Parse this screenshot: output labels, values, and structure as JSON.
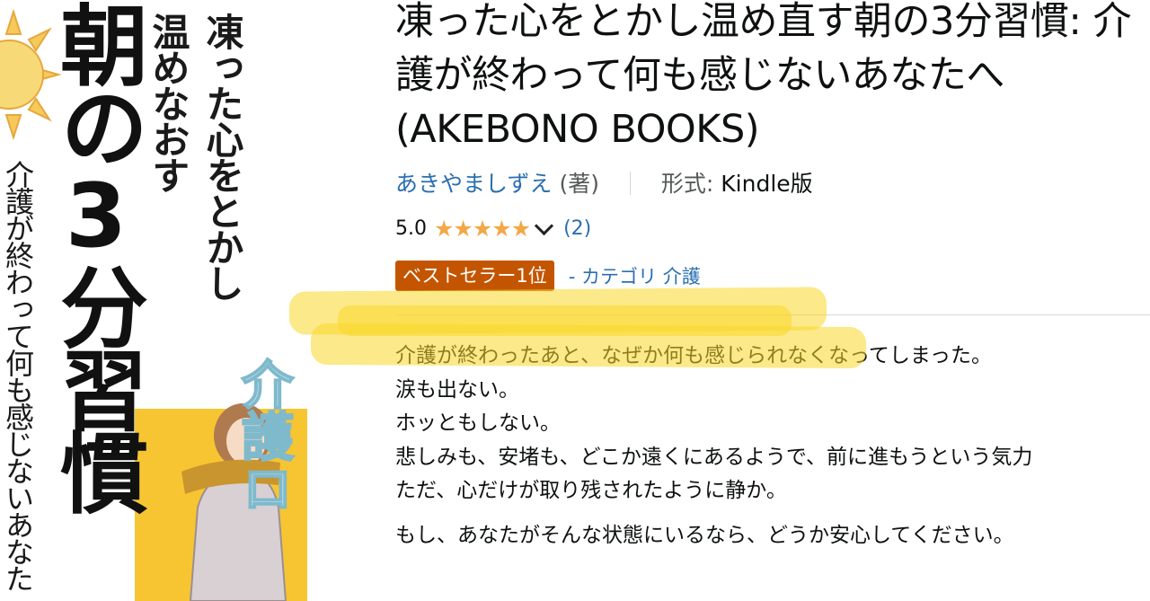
{
  "cover": {
    "subtitle_right": "凍った心をとかし",
    "subtitle_left": "温めなおす",
    "main_title": "朝の3分習慣",
    "side_text": "介護が終わって何も感じないあなた",
    "badge_text": "介護ロ"
  },
  "product": {
    "title": "凍った心をとかし温め直す朝の3分習慣: 介護が終わって何も感じないあなたへ (AKEBONO BOOKS)",
    "author": "あきやましずえ",
    "author_role": "(著)",
    "format_label": "形式:",
    "format_value": "Kindle版",
    "rating_value": "5.0",
    "stars": "★★★★★",
    "rating_count": "(2)",
    "bestseller_badge": "ベストセラー1位",
    "category_link": "- カテゴリ 介護",
    "description": [
      "介護が終わったあと、なぜか何も感じられなくなってしまった。",
      "涙も出ない。",
      "ホッともしない。",
      "悲しみも、安堵も、どこか遠くにあるようで、前に進もうという気力",
      "ただ、心だけが取り残されたように静か。"
    ],
    "description_last": "もし、あなたがそんな状態にいるなら、どうか安心してください。"
  },
  "colors": {
    "link": "#2a6fb0",
    "star": "#f3a847",
    "badge": "#c45500",
    "highlighter": "#f7d21f",
    "cover_yellow": "#f7c531"
  }
}
